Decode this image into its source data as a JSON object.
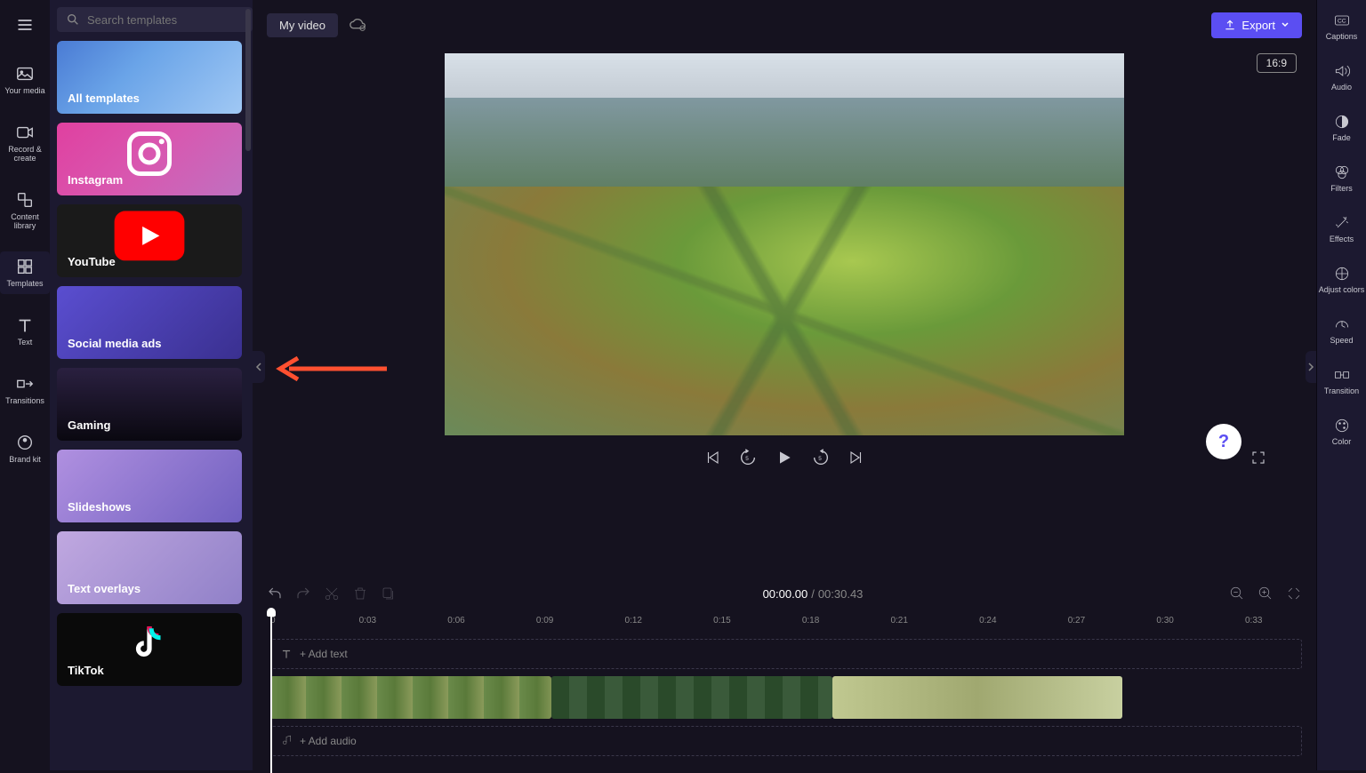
{
  "leftRail": {
    "items": [
      {
        "label": "Your media"
      },
      {
        "label": "Record & create"
      },
      {
        "label": "Content library"
      },
      {
        "label": "Templates"
      },
      {
        "label": "Text"
      },
      {
        "label": "Transitions"
      },
      {
        "label": "Brand kit"
      }
    ]
  },
  "search": {
    "placeholder": "Search templates"
  },
  "templates": [
    {
      "label": "All templates"
    },
    {
      "label": "Instagram"
    },
    {
      "label": "YouTube"
    },
    {
      "label": "Social media ads"
    },
    {
      "label": "Gaming"
    },
    {
      "label": "Slideshows"
    },
    {
      "label": "Text overlays"
    },
    {
      "label": "TikTok"
    }
  ],
  "project": {
    "name": "My video"
  },
  "export": {
    "label": "Export"
  },
  "aspect": {
    "label": "16:9"
  },
  "time": {
    "current": "00:00.00",
    "sep": "/",
    "total": "00:30.43"
  },
  "ruler": [
    "0",
    "0:03",
    "0:06",
    "0:09",
    "0:12",
    "0:15",
    "0:18",
    "0:21",
    "0:24",
    "0:27",
    "0:30",
    "0:33"
  ],
  "tracks": {
    "text": "+ Add text",
    "audio": "+ Add audio"
  },
  "rightRail": {
    "items": [
      {
        "label": "Captions"
      },
      {
        "label": "Audio"
      },
      {
        "label": "Fade"
      },
      {
        "label": "Filters"
      },
      {
        "label": "Effects"
      },
      {
        "label": "Adjust colors"
      },
      {
        "label": "Speed"
      },
      {
        "label": "Transition"
      },
      {
        "label": "Color"
      }
    ]
  },
  "help": {
    "glyph": "?"
  }
}
